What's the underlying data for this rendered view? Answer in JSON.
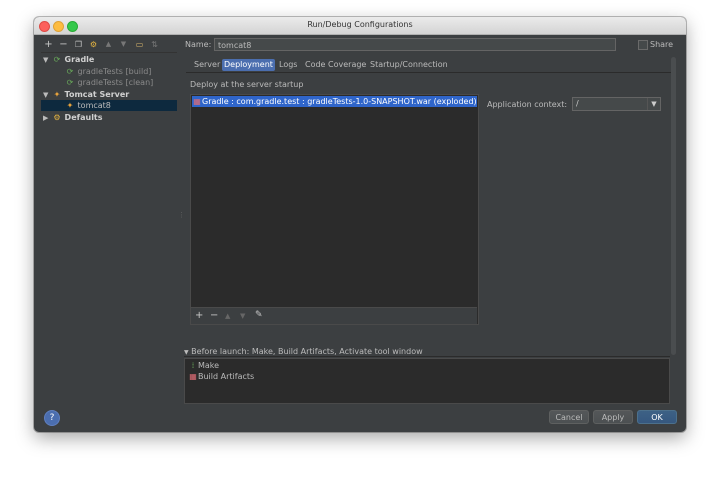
{
  "window": {
    "title": "Run/Debug Configurations"
  },
  "toolbar": {
    "add": "+",
    "remove": "−"
  },
  "tree": {
    "gradle": {
      "label": "Gradle",
      "children": [
        "gradleTests [build]",
        "gradleTests [clean]"
      ]
    },
    "tomcat": {
      "label": "Tomcat Server",
      "children": [
        "tomcat8"
      ]
    },
    "defaults": {
      "label": "Defaults"
    }
  },
  "form": {
    "name_label": "Name:",
    "name_value": "tomcat8",
    "share_label": "Share",
    "tabs": [
      "Server",
      "Deployment",
      "Logs",
      "Code Coverage",
      "Startup/Connection"
    ],
    "active_tab": "Deployment"
  },
  "deployment": {
    "header": "Deploy at the server startup",
    "artifact": "Gradle : com.gradle.test : gradleTests-1.0-SNAPSHOT.war (exploded)",
    "context_label": "Application context:",
    "context_value": "/"
  },
  "before_launch": {
    "header": "Before launch: Make, Build Artifacts, Activate tool window",
    "items": [
      "Make",
      "Build Artifacts"
    ]
  },
  "buttons": {
    "help": "?",
    "cancel": "Cancel",
    "apply": "Apply",
    "ok": "OK"
  }
}
